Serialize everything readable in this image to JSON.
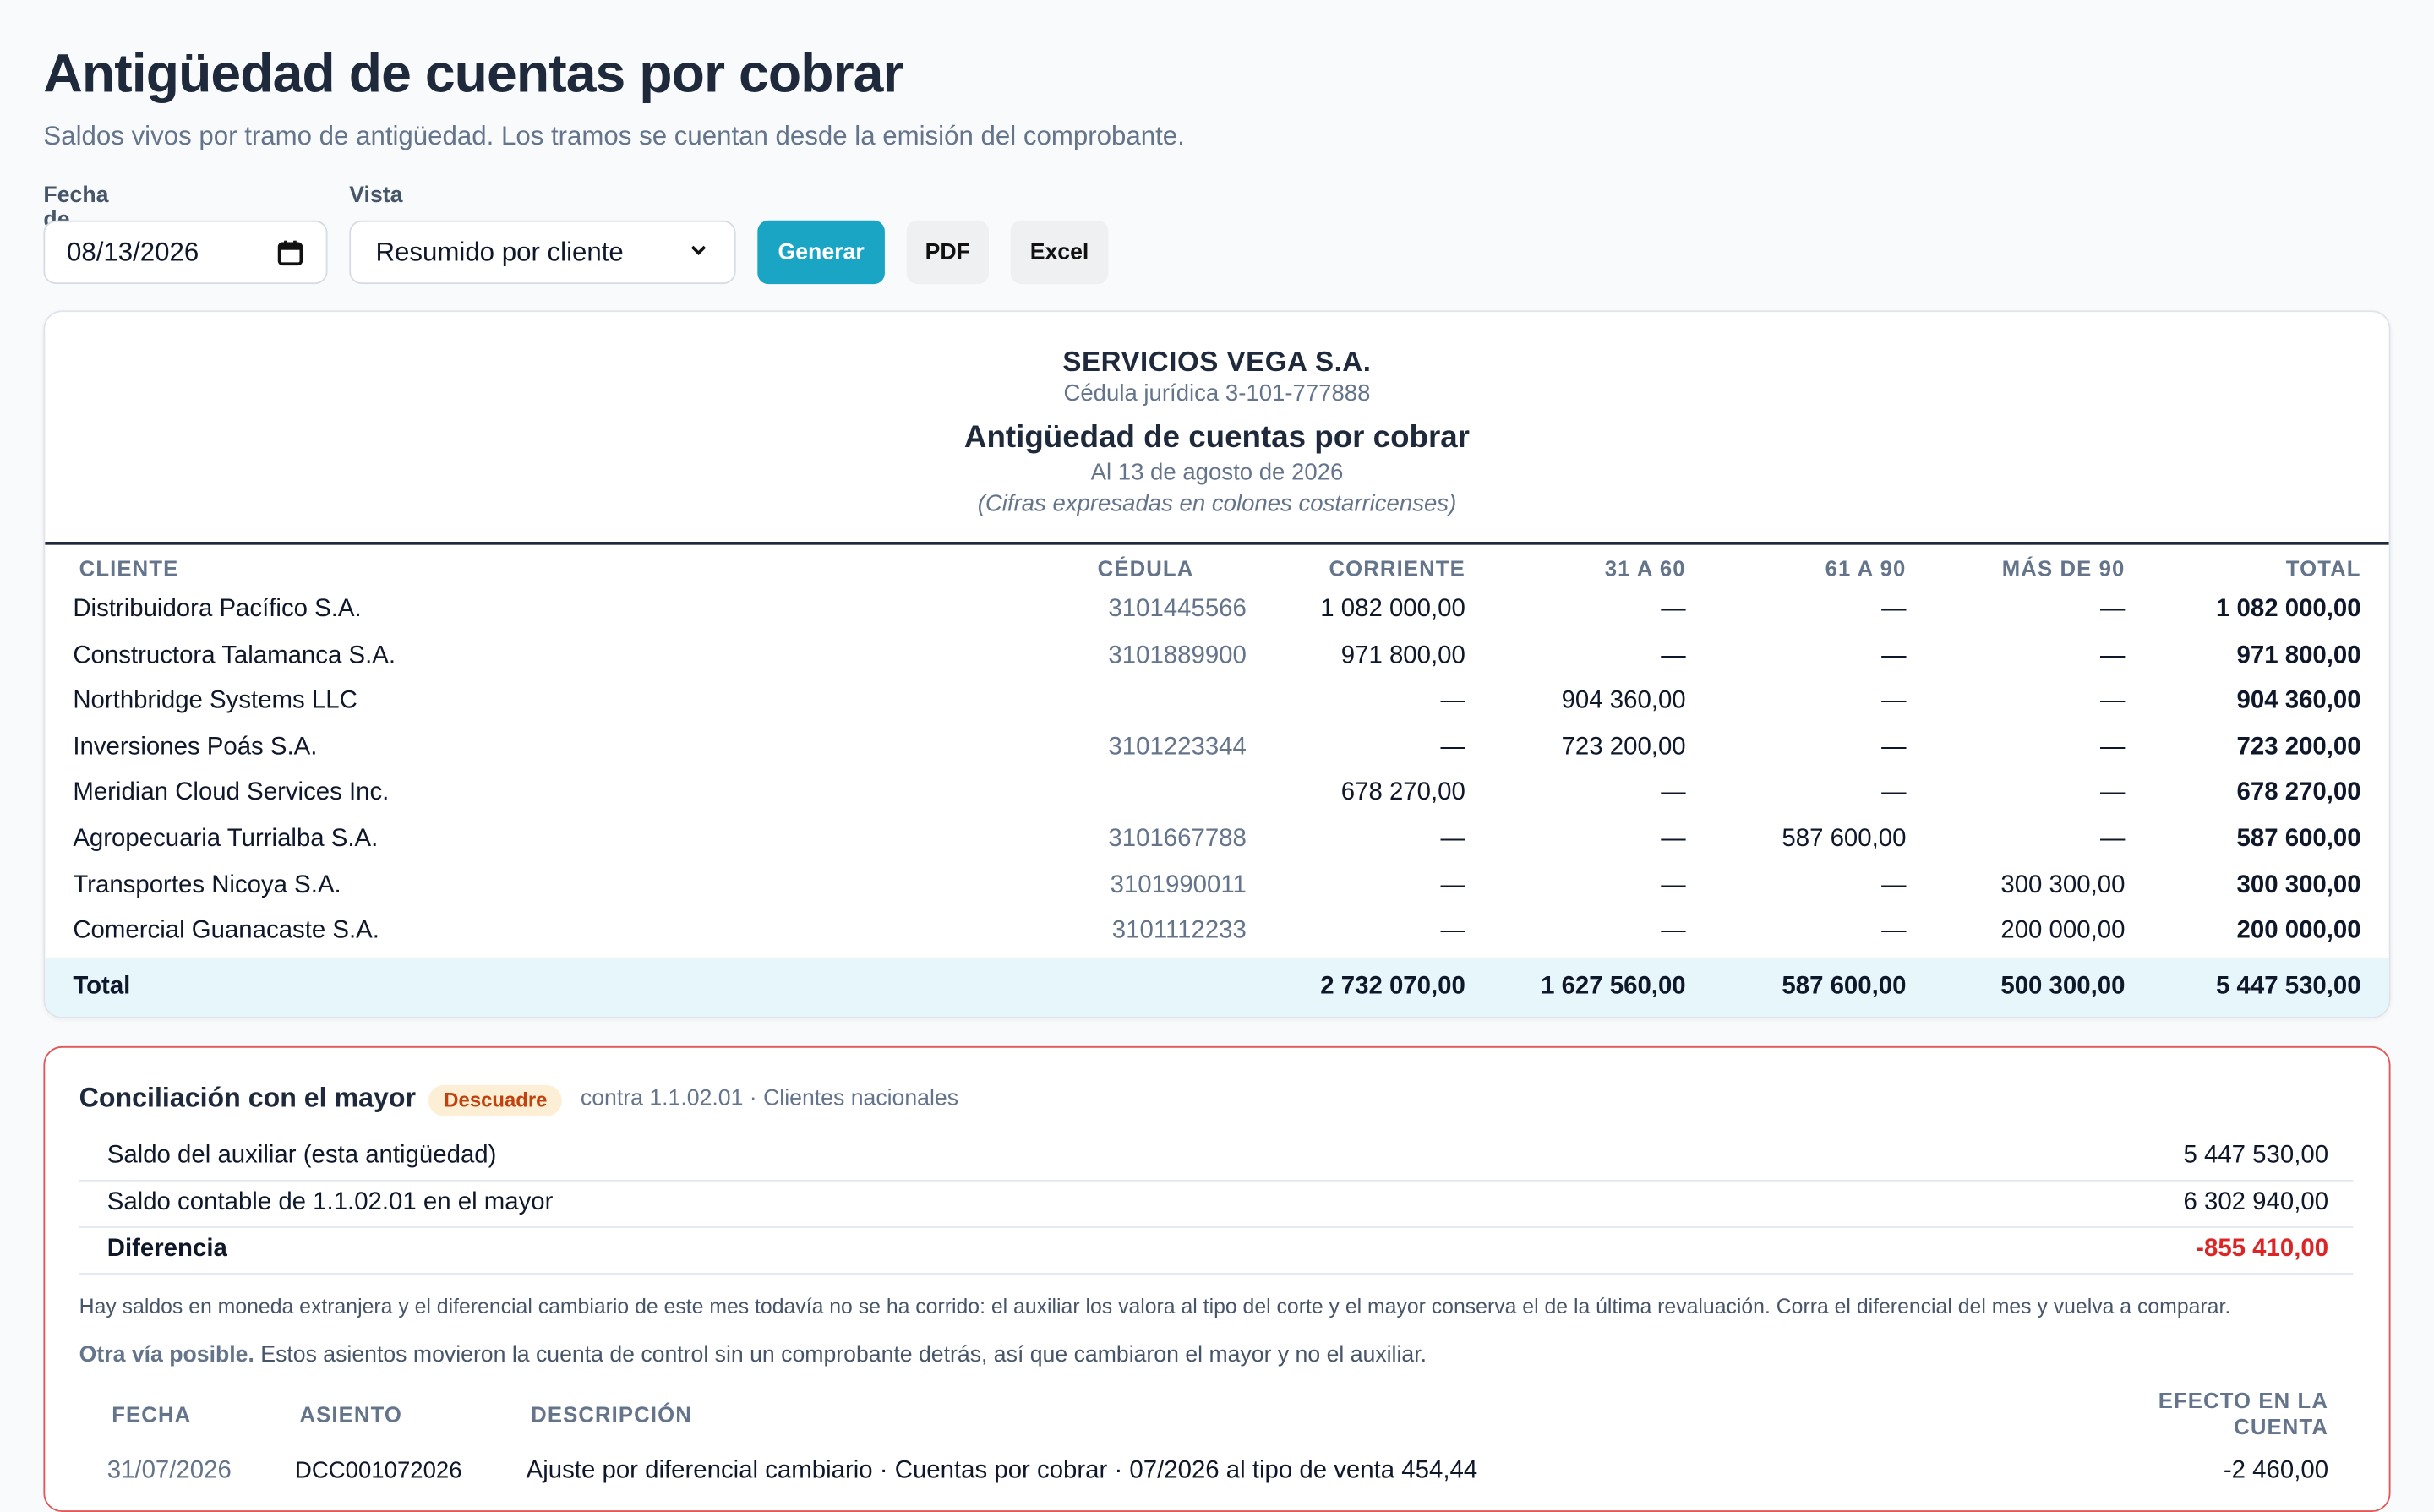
{
  "header": {
    "title": "Antigüedad de cuentas por cobrar",
    "subtitle": "Saldos vivos por tramo de antigüedad. Los tramos se cuentan desde la emisión del comprobante."
  },
  "controls": {
    "date_label": "Fecha de corte",
    "date_value": "08/13/2026",
    "view_label": "Vista",
    "view_value": "Resumido por cliente",
    "generate_label": "Generar",
    "pdf_label": "PDF",
    "excel_label": "Excel",
    "primary_color": "#1aa5c4"
  },
  "report": {
    "company": "SERVICIOS VEGA S.A.",
    "cedula": "Cédula jurídica 3-101-777888",
    "title": "Antigüedad de cuentas por cobrar",
    "date": "Al 13 de agosto de 2026",
    "note": "(Cifras expresadas en colones costarricenses)",
    "columns": [
      "CLIENTE",
      "CÉDULA",
      "CORRIENTE",
      "31 A 60",
      "61 A 90",
      "MÁS DE 90",
      "TOTAL"
    ],
    "rows": [
      {
        "client": "Distribuidora Pacífico S.A.",
        "cedula": "3101445566",
        "cur": "1 082 000,00",
        "b3160": "—",
        "b6190": "—",
        "b90": "—",
        "total": "1 082 000,00"
      },
      {
        "client": "Constructora Talamanca S.A.",
        "cedula": "3101889900",
        "cur": "971 800,00",
        "b3160": "—",
        "b6190": "—",
        "b90": "—",
        "total": "971 800,00"
      },
      {
        "client": "Northbridge Systems LLC",
        "cedula": "",
        "cur": "—",
        "b3160": "904 360,00",
        "b6190": "—",
        "b90": "—",
        "total": "904 360,00"
      },
      {
        "client": "Inversiones Poás S.A.",
        "cedula": "3101223344",
        "cur": "—",
        "b3160": "723 200,00",
        "b6190": "—",
        "b90": "—",
        "total": "723 200,00"
      },
      {
        "client": "Meridian Cloud Services Inc.",
        "cedula": "",
        "cur": "678 270,00",
        "b3160": "—",
        "b6190": "—",
        "b90": "—",
        "total": "678 270,00"
      },
      {
        "client": "Agropecuaria Turrialba S.A.",
        "cedula": "3101667788",
        "cur": "—",
        "b3160": "—",
        "b6190": "587 600,00",
        "b90": "—",
        "total": "587 600,00"
      },
      {
        "client": "Transportes Nicoya S.A.",
        "cedula": "3101990011",
        "cur": "—",
        "b3160": "—",
        "b6190": "—",
        "b90": "300 300,00",
        "total": "300 300,00"
      },
      {
        "client": "Comercial Guanacaste S.A.",
        "cedula": "3101112233",
        "cur": "—",
        "b3160": "—",
        "b6190": "—",
        "b90": "200 000,00",
        "total": "200 000,00"
      }
    ],
    "total": {
      "label": "Total",
      "cur": "2 732 070,00",
      "b3160": "1 627 560,00",
      "b6190": "587 600,00",
      "b90": "500 300,00",
      "total": "5 447 530,00"
    }
  },
  "recon": {
    "title": "Conciliación con el mayor",
    "badge": "Descuadre",
    "subtitle": "contra 1.1.02.01 · Clientes nacionales",
    "aux_label": "Saldo del auxiliar (esta antigüedad)",
    "aux_value": "5 447 530,00",
    "ledger_label": "Saldo contable de 1.1.02.01 en el mayor",
    "ledger_value": "6 302 940,00",
    "diff_label": "Diferencia",
    "diff_value": "-855 410,00",
    "note": "Hay saldos en moneda extranjera y el diferencial cambiario de este mes todavía no se ha corrido: el auxiliar los valora al tipo del corte y el mayor conserva el de la última revaluación. Corra el diferencial del mes y vuelva a comparar.",
    "alt_bold": "Otra vía posible.",
    "alt_text": " Estos asientos movieron la cuenta de control sin un comprobante detrás, así que cambiaron el mayor y no el auxiliar.",
    "mv_columns": [
      "FECHA",
      "ASIENTO",
      "DESCRIPCIÓN",
      "EFECTO EN LA",
      "CUENTA"
    ],
    "movements": [
      {
        "date": "31/07/2026",
        "entry": "DCC001072026",
        "desc": "Ajuste por diferencial cambiario · Cuentas por cobrar · 07/2026 al tipo de venta 454,44",
        "effect": "-2 460,00"
      }
    ]
  }
}
